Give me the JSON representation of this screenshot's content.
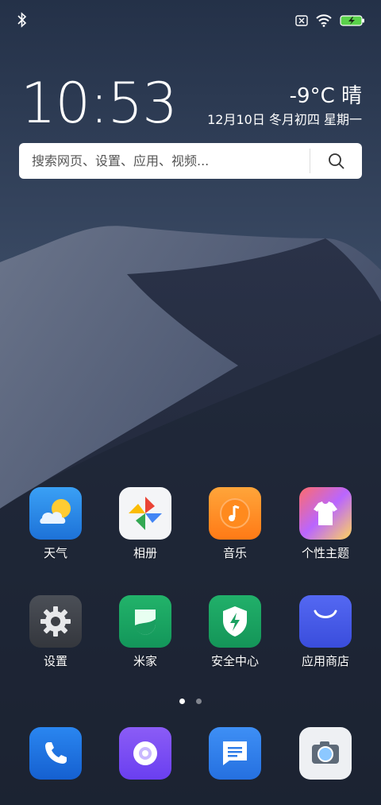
{
  "status_bar": {
    "icons": [
      "bluetooth-icon",
      "no-sim-icon",
      "wifi-icon",
      "battery-charging-icon"
    ]
  },
  "clock": {
    "time": "10:53"
  },
  "weather": {
    "temp_condition": "-9°C  晴",
    "date": "12月10日 冬月初四  星期一"
  },
  "search": {
    "placeholder": "搜索网页、设置、应用、视频..."
  },
  "apps": [
    {
      "label": "天气",
      "icon": "weather-icon"
    },
    {
      "label": "相册",
      "icon": "gallery-icon"
    },
    {
      "label": "音乐",
      "icon": "music-icon"
    },
    {
      "label": "个性主题",
      "icon": "themes-icon"
    },
    {
      "label": "设置",
      "icon": "settings-icon"
    },
    {
      "label": "米家",
      "icon": "mihome-icon"
    },
    {
      "label": "安全中心",
      "icon": "security-icon"
    },
    {
      "label": "应用商店",
      "icon": "app-store-icon"
    }
  ],
  "page_indicator": {
    "pages": 2,
    "active": 1
  },
  "dock": [
    {
      "icon": "phone-icon"
    },
    {
      "icon": "browser-icon"
    },
    {
      "icon": "messages-icon"
    },
    {
      "icon": "camera-icon"
    }
  ],
  "colors": {
    "accent": "#2a8df0",
    "search_bg": "#ffffff"
  }
}
